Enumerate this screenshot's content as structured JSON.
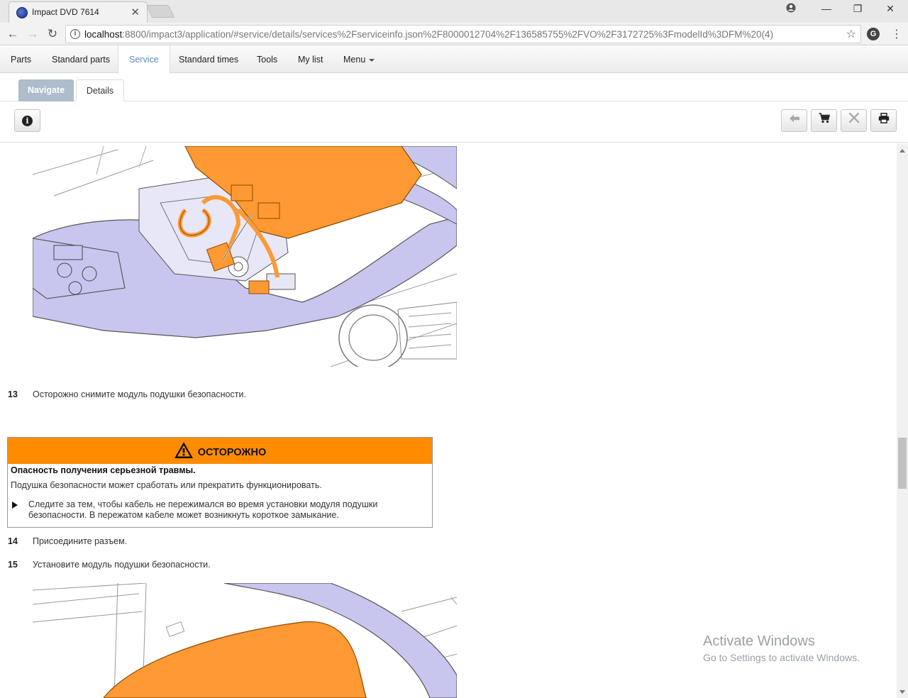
{
  "browser": {
    "tab_title": "Impact DVD 7614",
    "url_host": "localhost",
    "url_rest": ":8800/impact3/application/#service/details/services%2Fserviceinfo.json%2F8000012704%2F136585755%2FVO%2F3172725%3FmodelId%3DFM%20(4)"
  },
  "menubar": {
    "items": [
      "Parts",
      "Standard parts",
      "Service",
      "Standard times",
      "Tools",
      "My list",
      "Menu"
    ],
    "active": "Service"
  },
  "subtabs": {
    "navigate": "Navigate",
    "details": "Details"
  },
  "steps": [
    {
      "num": "13",
      "text": "Осторожно снимите модуль подушки безопасности."
    },
    {
      "num": "14",
      "text": "Присоедините разъем."
    },
    {
      "num": "15",
      "text": "Установите модуль подушки безопасности."
    }
  ],
  "warning": {
    "heading": "ОСТОРОЖНО",
    "title": "Опасность получения серьезной травмы.",
    "text": "Подушка безопасности может сработать или прекратить функционировать.",
    "bullet": "Следите за тем, чтобы кабель не пережимался во время установки модуля подушки безопасности. В пережатом кабеле может возникнуть короткое замыкание.",
    "color": "#ff8c00"
  },
  "watermark": {
    "line1": "Activate Windows",
    "line2": "Go to Settings to activate Windows."
  },
  "colors": {
    "part_highlight": "#ff9933",
    "panel_fill": "#c8c6ee",
    "active_menu": "#5b8bbf",
    "navigate_tab": "#aebccc"
  }
}
